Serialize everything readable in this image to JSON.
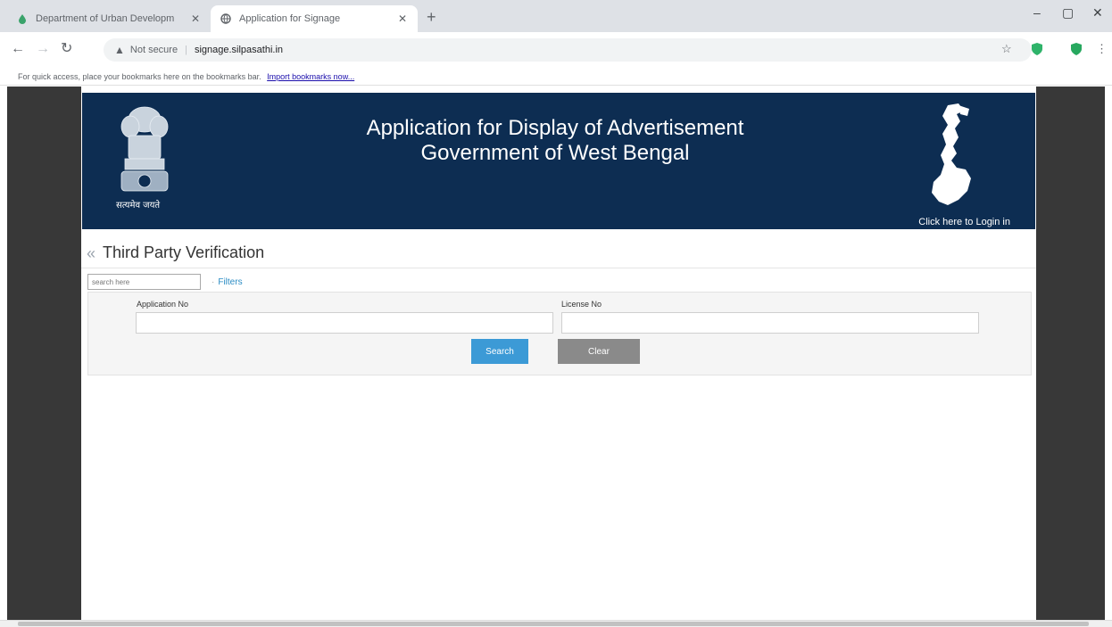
{
  "browser": {
    "tabs": [
      {
        "title": "Department of Urban Developm",
        "active": false,
        "favicon": "droplet-icon"
      },
      {
        "title": "Application for Signage",
        "active": true,
        "favicon": "globe-icon"
      }
    ],
    "new_tab": "+",
    "security_label": "Not secure",
    "url": "signage.silpasathi.in",
    "bookmarks_hint": "For quick access, place your bookmarks here on the bookmarks bar.",
    "bookmarks_import": "Import bookmarks now..."
  },
  "banner": {
    "title_line1": "Application for Display of Advertisement",
    "title_line2": "Government of West Bengal",
    "emblem_caption": "सत्यमेव जयते",
    "login_link": "Click here to Login in"
  },
  "page": {
    "title": "Third Party Verification",
    "search_placeholder": "search here",
    "filters_label": "Filters"
  },
  "filters": {
    "application_no_label": "Application No",
    "application_no_value": "",
    "license_no_label": "License No",
    "license_no_value": "",
    "search_button": "Search",
    "clear_button": "Clear"
  },
  "colors": {
    "banner_bg": "#0d2d52",
    "search_btn": "#3c9ad6",
    "clear_btn": "#8a8a8a",
    "outer_bg": "#383838"
  }
}
